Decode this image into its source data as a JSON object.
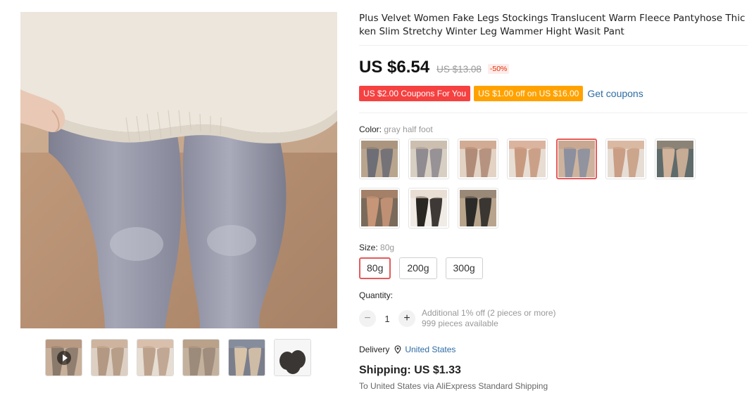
{
  "product": {
    "title": "Plus Velvet Women Fake Legs Stockings Translucent Warm Fleece Pantyhose Thicken Slim Stretchy Winter Leg Wammer Hight Wasit Pant"
  },
  "price": {
    "current": "US $6.54",
    "original": "US $13.08",
    "discount": "-50%"
  },
  "coupons": {
    "coupon_1": "US $2.00 Coupons For You",
    "coupon_2": "US $1.00 off on US $16.00",
    "get_coupons": "Get coupons"
  },
  "color": {
    "label": "Color: ",
    "selected": "gray half foot",
    "options": [
      {
        "icon": "stocking-photo",
        "skin": "#a58f78",
        "leg": "#6e6e76",
        "bg": "#b9a58e"
      },
      {
        "icon": "stocking-photo",
        "skin": "#c7b8a8",
        "leg": "#8f8b90",
        "bg": "#d8cfc3"
      },
      {
        "icon": "stocking-photo",
        "skin": "#c99a7e",
        "leg": "#b08c78",
        "bg": "#e3d3c5"
      },
      {
        "icon": "stocking-photo",
        "skin": "#d5a289",
        "leg": "#c79a80",
        "bg": "#e8ddd3"
      },
      {
        "icon": "stocking-photo",
        "skin": "#c7a48c",
        "leg": "#8b8f9e",
        "bg": "#cdb39e"
      },
      {
        "icon": "stocking-photo",
        "skin": "#d4a98d",
        "leg": "#c99e85",
        "bg": "#e6ddd5"
      },
      {
        "icon": "stocking-photo",
        "skin": "#9f8d7d",
        "leg": "#d1b29a",
        "bg": "#5f6b6a"
      },
      {
        "icon": "stocking-photo",
        "skin": "#b58a6c",
        "leg": "#c79577",
        "bg": "#7a6a5a"
      },
      {
        "icon": "stocking-photo",
        "skin": "#e5d8cc",
        "leg": "#2a2622",
        "bg": "#f0ebe5"
      },
      {
        "icon": "stocking-photo",
        "skin": "#8e7d6d",
        "leg": "#2c2a28",
        "bg": "#b8a48c"
      }
    ],
    "selected_index": 4
  },
  "size": {
    "label": "Size: ",
    "selected": "80g",
    "options": [
      "80g",
      "200g",
      "300g"
    ]
  },
  "quantity": {
    "label": "Quantity:",
    "value": "1",
    "minus": "−",
    "plus": "+",
    "note_1": "Additional 1% off (2 pieces or more)",
    "note_2": "999 pieces available"
  },
  "delivery": {
    "label": "Delivery",
    "location": "United States",
    "pin_icon": "location-pin-icon"
  },
  "shipping": {
    "title": "Shipping: US $1.33",
    "subtitle": "To United States via AliExpress Standard Shipping"
  },
  "gallery": {
    "thumbnails": [
      {
        "icon": "video-play-icon",
        "skin": "#b09078",
        "leg": "#8a7a6c",
        "bg": "#c8b09a"
      },
      {
        "icon": "stocking-photo",
        "skin": "#c8a88e",
        "leg": "#b39883",
        "bg": "#ddd0c3"
      },
      {
        "icon": "stocking-photo",
        "skin": "#d3b49c",
        "leg": "#bca28d",
        "bg": "#e6ddd3"
      },
      {
        "icon": "stocking-photo",
        "skin": "#b59a82",
        "leg": "#9c8a7a",
        "bg": "#c4b19d"
      },
      {
        "icon": "stocking-photo",
        "skin": "#8a93a3",
        "leg": "#d8c3a8",
        "bg": "#7b7f8c"
      },
      {
        "icon": "fleece-roll-photo",
        "skin": "#444",
        "leg": "#3a3633",
        "bg": "#f6f6f6"
      }
    ]
  }
}
